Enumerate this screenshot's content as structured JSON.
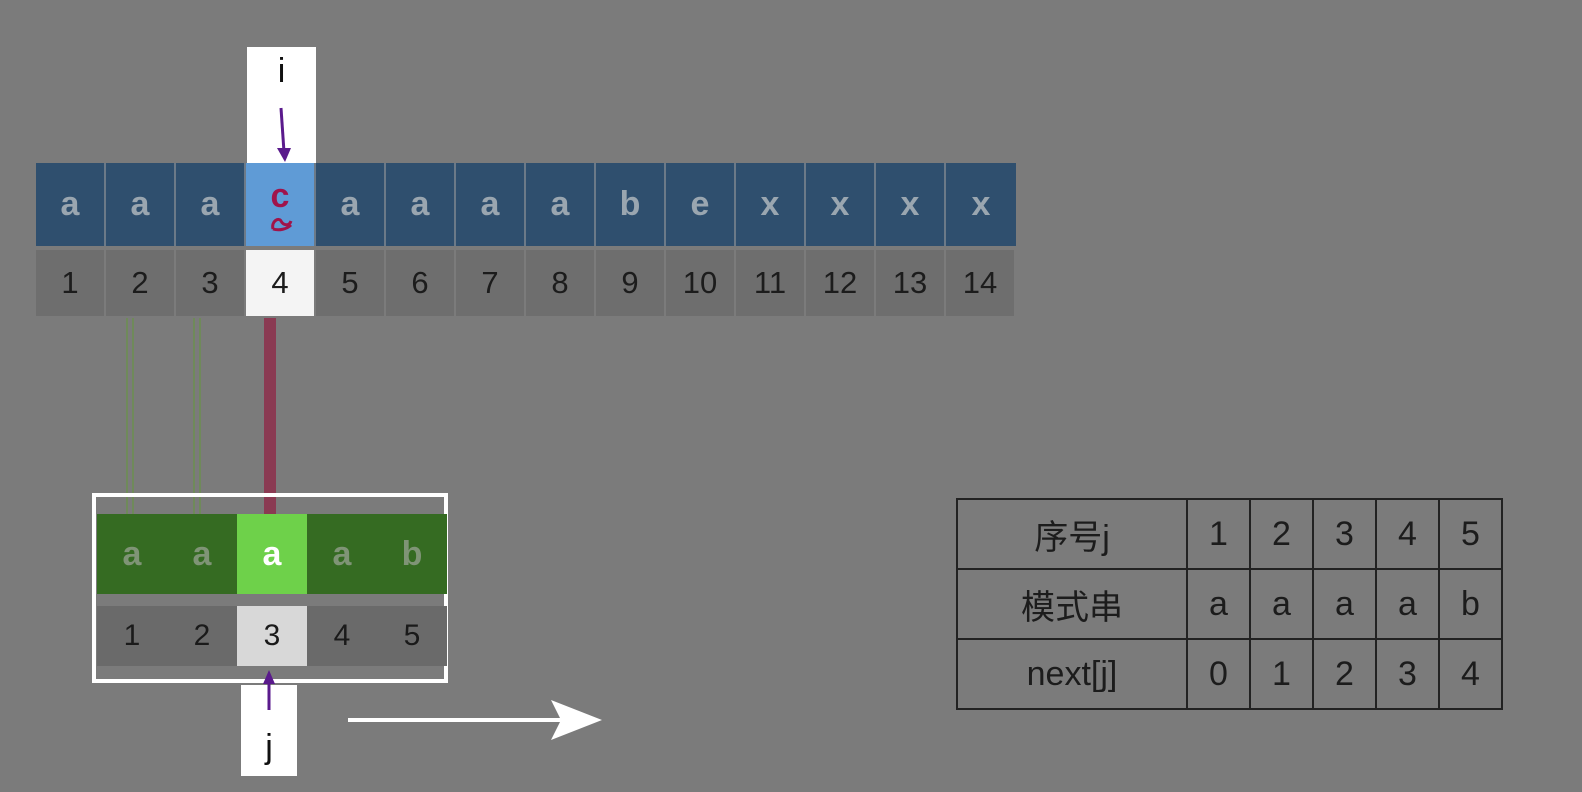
{
  "main": {
    "chars": [
      "a",
      "a",
      "a",
      "c",
      "a",
      "a",
      "a",
      "a",
      "b",
      "e",
      "x",
      "x",
      "x",
      "x"
    ],
    "indices": [
      "1",
      "2",
      "3",
      "4",
      "5",
      "6",
      "7",
      "8",
      "9",
      "10",
      "11",
      "12",
      "13",
      "14"
    ],
    "pointer_label": "i"
  },
  "pattern": {
    "chars": [
      "a",
      "a",
      "a",
      "a",
      "b"
    ],
    "indices": [
      "1",
      "2",
      "3",
      "4",
      "5"
    ],
    "pointer_label": "j"
  },
  "table": {
    "rows": [
      {
        "header": "序号j",
        "values": [
          "1",
          "2",
          "3",
          "4",
          "5"
        ]
      },
      {
        "header": "模式串",
        "values": [
          "a",
          "a",
          "a",
          "a",
          "b"
        ]
      },
      {
        "header": "next[j]",
        "values": [
          "0",
          "1",
          "2",
          "3",
          "4"
        ]
      }
    ]
  },
  "colors": {
    "background": "#7b7b7b",
    "main_cell": "#2f4f6e",
    "main_highlight": "#5f9bd6",
    "pattern_cell": "#356b22",
    "pattern_highlight": "#6ed14a",
    "pointer_arrow": "#5a1a8c",
    "match_line": "#6f8a5a",
    "mismatch_line": "#8a3a52"
  }
}
